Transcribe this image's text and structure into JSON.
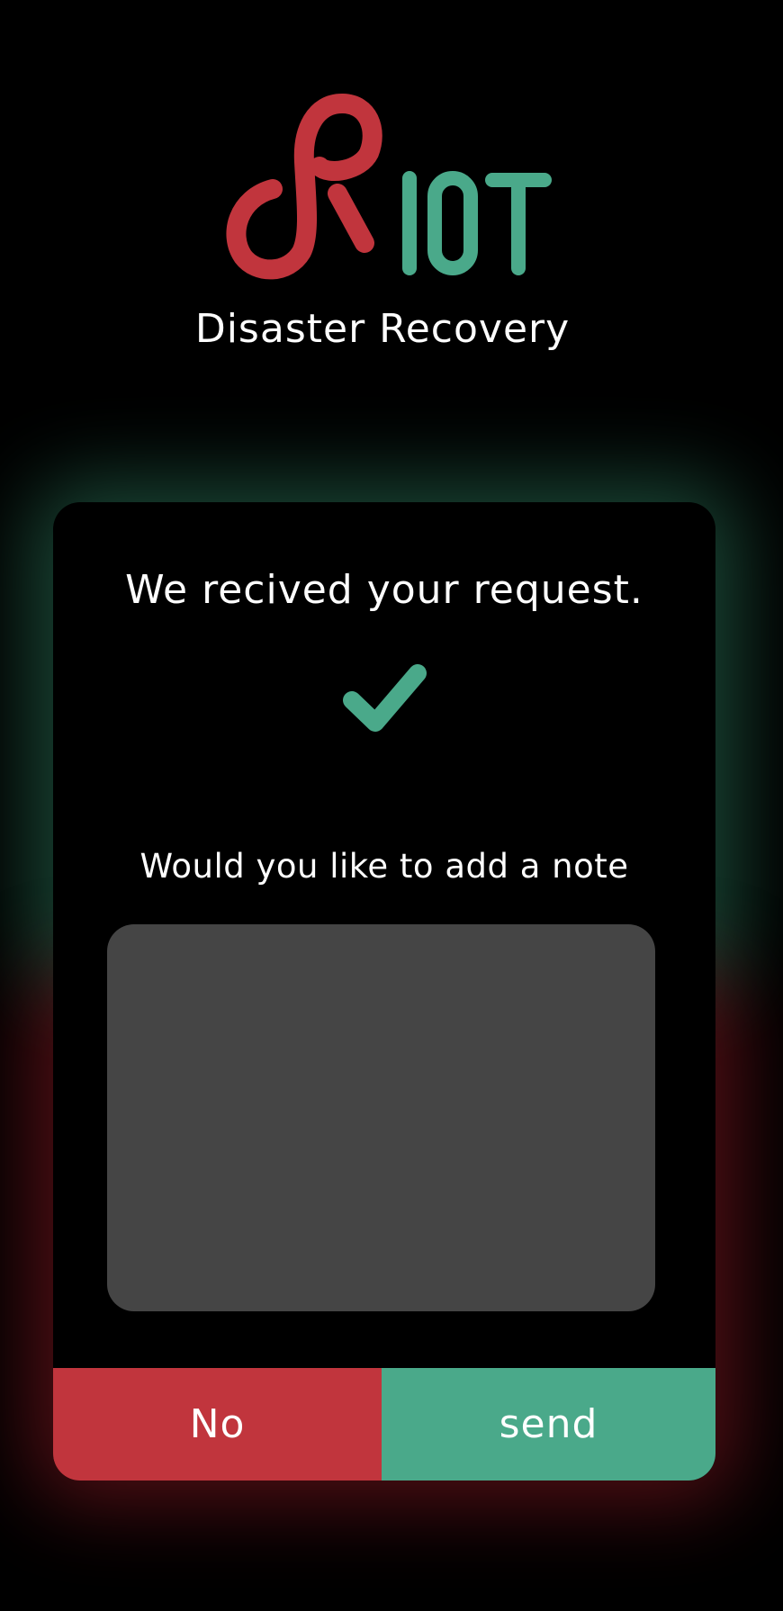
{
  "brand": {
    "logo_text": "RIOT",
    "subtitle": "Disaster Recovery",
    "red": "#c1353d",
    "green": "#4aa98a"
  },
  "card": {
    "headline": "We recived your request.",
    "check_icon": "checkmark-icon",
    "note_label": "Would you like to add a note",
    "note_value": "",
    "note_placeholder": ""
  },
  "buttons": {
    "no_label": "No",
    "send_label": "send"
  }
}
